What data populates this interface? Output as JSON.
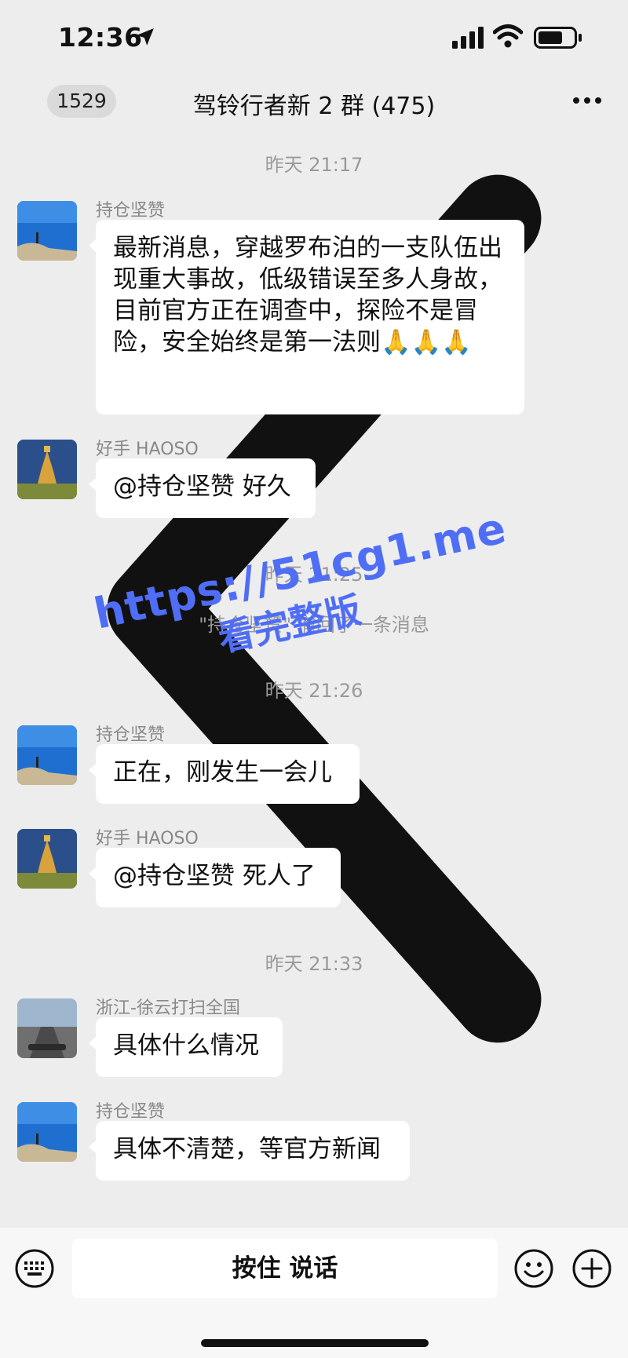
{
  "status_bar": {
    "time": "12:36"
  },
  "nav": {
    "unread_count": "1529",
    "title": "驾铃行者新 2 群 (475)"
  },
  "timestamps": [
    "昨天 21:17",
    "昨天 21:25",
    "昨天 21:26",
    "昨天 21:33"
  ],
  "system_notice": "\"持仓坚赞\" 撤回了一条消息",
  "messages": [
    {
      "sender": "持仓坚赞",
      "text": "最新消息，穿越罗布泊的一支队伍出现重大事故，低级错误至多人身故，目前官方正在调查中，探险不是冒险，安全始终是第一法则🙏🙏🙏"
    },
    {
      "sender": "好手 HAOSO",
      "text": "@持仓坚赞 好久"
    },
    {
      "sender": "持仓坚赞",
      "text": "正在，刚发生一会儿"
    },
    {
      "sender": "好手 HAOSO",
      "text": "@持仓坚赞 死人了"
    },
    {
      "sender": "浙江-徐云打扫全国",
      "text": "具体什么情况"
    },
    {
      "sender": "持仓坚赞",
      "text": "具体不清楚，等官方新闻"
    }
  ],
  "watermark": {
    "line1": "https://51cg1.me",
    "line2": "看完整版"
  },
  "input_bar": {
    "voice_label": "按住 说话"
  }
}
